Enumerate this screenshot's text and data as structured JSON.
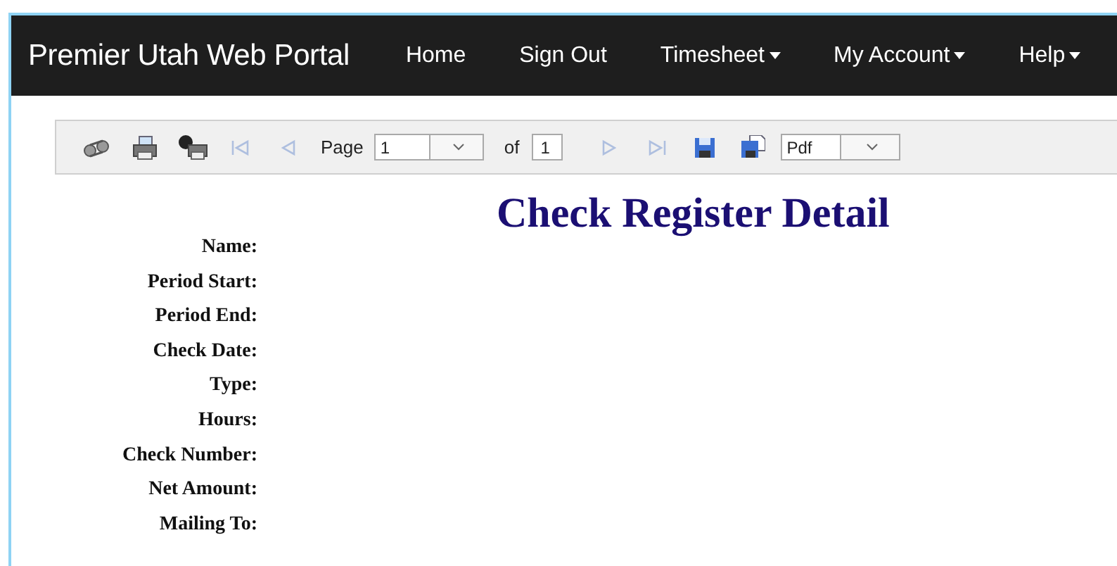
{
  "navbar": {
    "brand": "Premier Utah Web Portal",
    "items": [
      {
        "label": "Home",
        "dropdown": false
      },
      {
        "label": "Sign Out",
        "dropdown": false
      },
      {
        "label": "Timesheet",
        "dropdown": true
      },
      {
        "label": "My Account",
        "dropdown": true
      },
      {
        "label": "Help",
        "dropdown": true
      }
    ]
  },
  "toolbar": {
    "tools_before": [
      {
        "kind": "find",
        "disabled": false
      },
      {
        "kind": "print",
        "disabled": false
      },
      {
        "kind": "print-info",
        "disabled": false
      },
      {
        "kind": "first",
        "disabled": true
      },
      {
        "kind": "prev",
        "disabled": true
      }
    ],
    "page_label": "Page",
    "page_value": "1",
    "of_label": "of",
    "page_count": "1",
    "tools_after": [
      {
        "kind": "next",
        "disabled": true
      },
      {
        "kind": "last",
        "disabled": true
      },
      {
        "kind": "save",
        "disabled": false
      },
      {
        "kind": "save-as",
        "disabled": false
      }
    ],
    "format": "Pdf"
  },
  "report": {
    "title": "Check Register Detail",
    "fields": [
      "Name:",
      "Period Start:",
      "Period End:",
      "Check Date:",
      "Type:",
      "Hours:",
      "Check Number:",
      "Net Amount:",
      "Mailing To:"
    ]
  }
}
